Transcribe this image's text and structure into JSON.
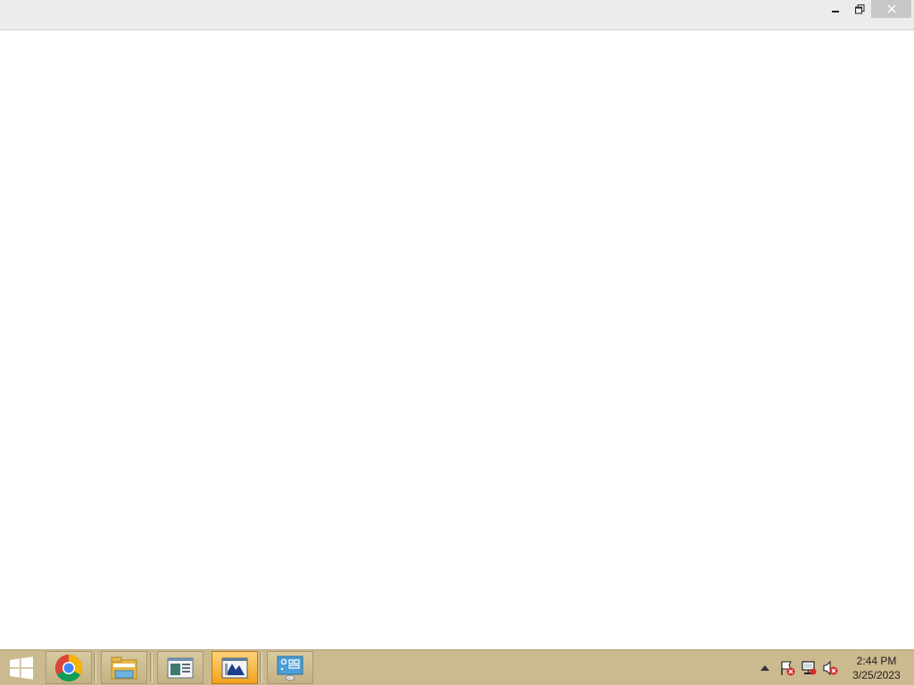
{
  "window": {
    "minimize_icon": "minimize-icon",
    "restore_icon": "restore-icon",
    "close_icon": "close-icon"
  },
  "taskbar": {
    "start_icon": "windows-logo-icon",
    "apps": [
      {
        "name": "Google Chrome",
        "icon": "chrome-icon"
      },
      {
        "name": "File Explorer",
        "icon": "folder-icon"
      },
      {
        "name": "App",
        "icon": "document-window-icon"
      },
      {
        "name": "App",
        "icon": "chart-window-icon",
        "active": true
      },
      {
        "name": "App",
        "icon": "control-panel-icon"
      }
    ],
    "tray": {
      "show_hidden_icon": "chevron-up-icon",
      "action_center_icon": "flag-error-icon",
      "network_icon": "network-error-icon",
      "volume_icon": "volume-muted-icon"
    },
    "clock": {
      "time": "2:44 PM",
      "date": "3/25/2023"
    }
  },
  "colors": {
    "taskbar": "#cbb98f",
    "titlebar": "#ececec",
    "active_task": "#f2a21c"
  }
}
